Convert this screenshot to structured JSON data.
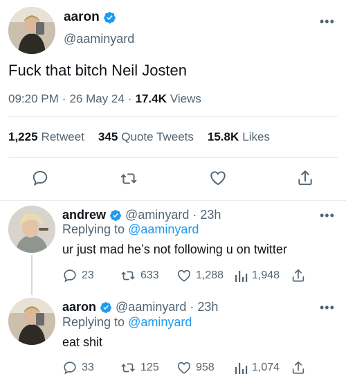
{
  "main_tweet": {
    "display_name": "aaron",
    "handle": "@aaminyard",
    "text": "Fuck that bitch Neil Josten",
    "time": "09:20 PM",
    "date": "26 May 24",
    "views_count": "17.4K",
    "views_label": "Views",
    "retweet_count": "1,225",
    "retweet_label": "Retweet",
    "quote_count": "345",
    "quote_label": "Quote Tweets",
    "likes_count": "15.8K",
    "likes_label": "Likes"
  },
  "replies": [
    {
      "display_name": "andrew",
      "handle": "@aminyard",
      "age": "23h",
      "replying_prefix": "Replying to",
      "replying_to": "@aaminyard",
      "text": "ur just mad he’s not following u on twitter",
      "replies": "23",
      "retweets": "633",
      "likes": "1,288",
      "views": "1,948"
    },
    {
      "display_name": "aaron",
      "handle": "@aaminyard",
      "age": "23h",
      "replying_prefix": "Replying to",
      "replying_to": "@aminyard",
      "text": "eat shit",
      "replies": "33",
      "retweets": "125",
      "likes": "958",
      "views": "1,074"
    }
  ],
  "separator": "·",
  "colors": {
    "accent": "#1d9bf0",
    "muted": "#536471",
    "text": "#0f1419",
    "divider": "#e6ecf0"
  },
  "icons": [
    "verified-badge-icon",
    "more-icon",
    "reply-icon",
    "retweet-icon",
    "like-icon",
    "share-icon",
    "views-icon"
  ]
}
